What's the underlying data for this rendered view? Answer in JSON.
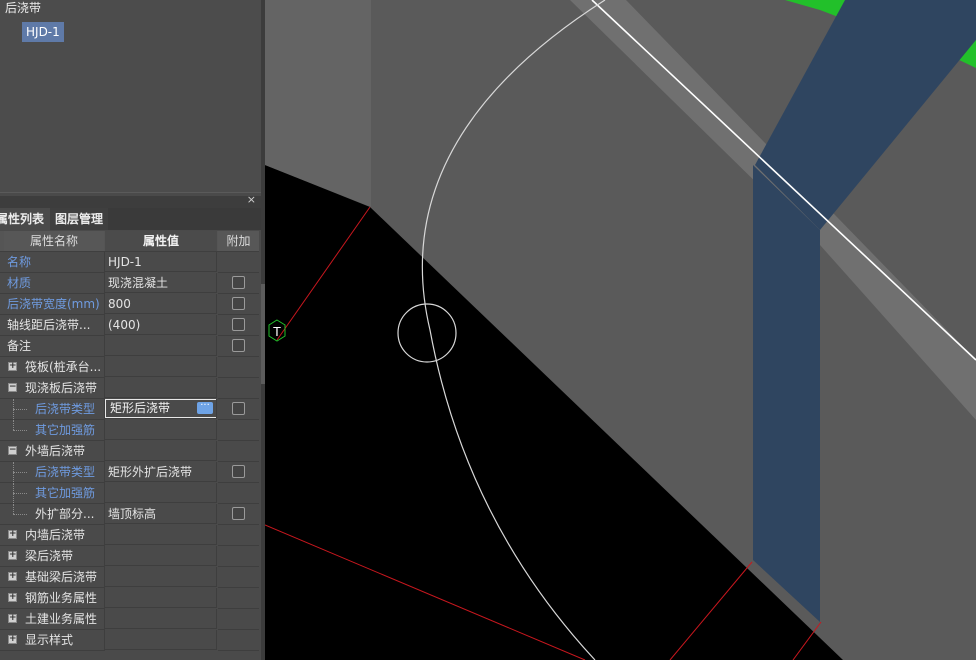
{
  "tree": {
    "root_label": "后浇带",
    "selected_item": "HJD-1"
  },
  "panel": {
    "close_glyph": "×",
    "tabs": [
      "属性列表",
      "图层管理"
    ],
    "columns": {
      "name": "属性名称",
      "value": "属性值",
      "extra": "附加"
    },
    "rows": [
      {
        "name": "名称",
        "value": "HJD-1",
        "name_color": "blue",
        "checkbox": false,
        "indent": 0
      },
      {
        "name": "材质",
        "value": "现浇混凝土",
        "name_color": "blue",
        "checkbox": true,
        "indent": 0
      },
      {
        "name": "后浇带宽度(mm)",
        "value": "800",
        "name_color": "blue",
        "checkbox": true,
        "indent": 0
      },
      {
        "name": "轴线距后浇带...",
        "value": "(400)",
        "name_color": "white",
        "checkbox": true,
        "indent": 0
      },
      {
        "name": "备注",
        "value": "",
        "name_color": "white",
        "checkbox": true,
        "indent": 0
      },
      {
        "name": "筏板(桩承台...",
        "value": "",
        "name_color": "white",
        "checkbox": false,
        "group": "plus"
      },
      {
        "name": "现浇板后浇带",
        "value": "",
        "name_color": "white",
        "checkbox": false,
        "group": "minus"
      },
      {
        "name": "后浇带类型",
        "value": "矩形后浇带",
        "name_color": "blue",
        "checkbox": true,
        "child": true,
        "editing": true
      },
      {
        "name": "其它加强筋",
        "value": "",
        "name_color": "blue",
        "checkbox": false,
        "child": true,
        "last": true
      },
      {
        "name": "外墙后浇带",
        "value": "",
        "name_color": "white",
        "checkbox": false,
        "group": "minus"
      },
      {
        "name": "后浇带类型",
        "value": "矩形外扩后浇带",
        "name_color": "blue",
        "checkbox": true,
        "child": true
      },
      {
        "name": "其它加强筋",
        "value": "",
        "name_color": "blue",
        "checkbox": false,
        "child": true
      },
      {
        "name": "外扩部分...",
        "value": "墙顶标高",
        "name_color": "white",
        "checkbox": true,
        "child": true,
        "last": true
      },
      {
        "name": "内墙后浇带",
        "value": "",
        "name_color": "white",
        "checkbox": false,
        "group": "plus"
      },
      {
        "name": "梁后浇带",
        "value": "",
        "name_color": "white",
        "checkbox": false,
        "group": "plus"
      },
      {
        "name": "基础梁后浇带",
        "value": "",
        "name_color": "white",
        "checkbox": false,
        "group": "plus"
      },
      {
        "name": "钢筋业务属性",
        "value": "",
        "name_color": "white",
        "checkbox": false,
        "group": "plus"
      },
      {
        "name": "土建业务属性",
        "value": "",
        "name_color": "white",
        "checkbox": false,
        "group": "plus"
      },
      {
        "name": "显示样式",
        "value": "",
        "name_color": "white",
        "checkbox": false,
        "group": "plus"
      }
    ]
  },
  "viewport": {
    "axis_marker": "T",
    "colors": {
      "background": "#000000",
      "slab_gray": "#5a5a5a",
      "slab_gray_light": "#646464",
      "band_blue": "#2f4560",
      "green": "#22c02a",
      "axis_red": "#c8171e",
      "line_white": "#ffffff",
      "circle": "#d8d8d8"
    }
  }
}
